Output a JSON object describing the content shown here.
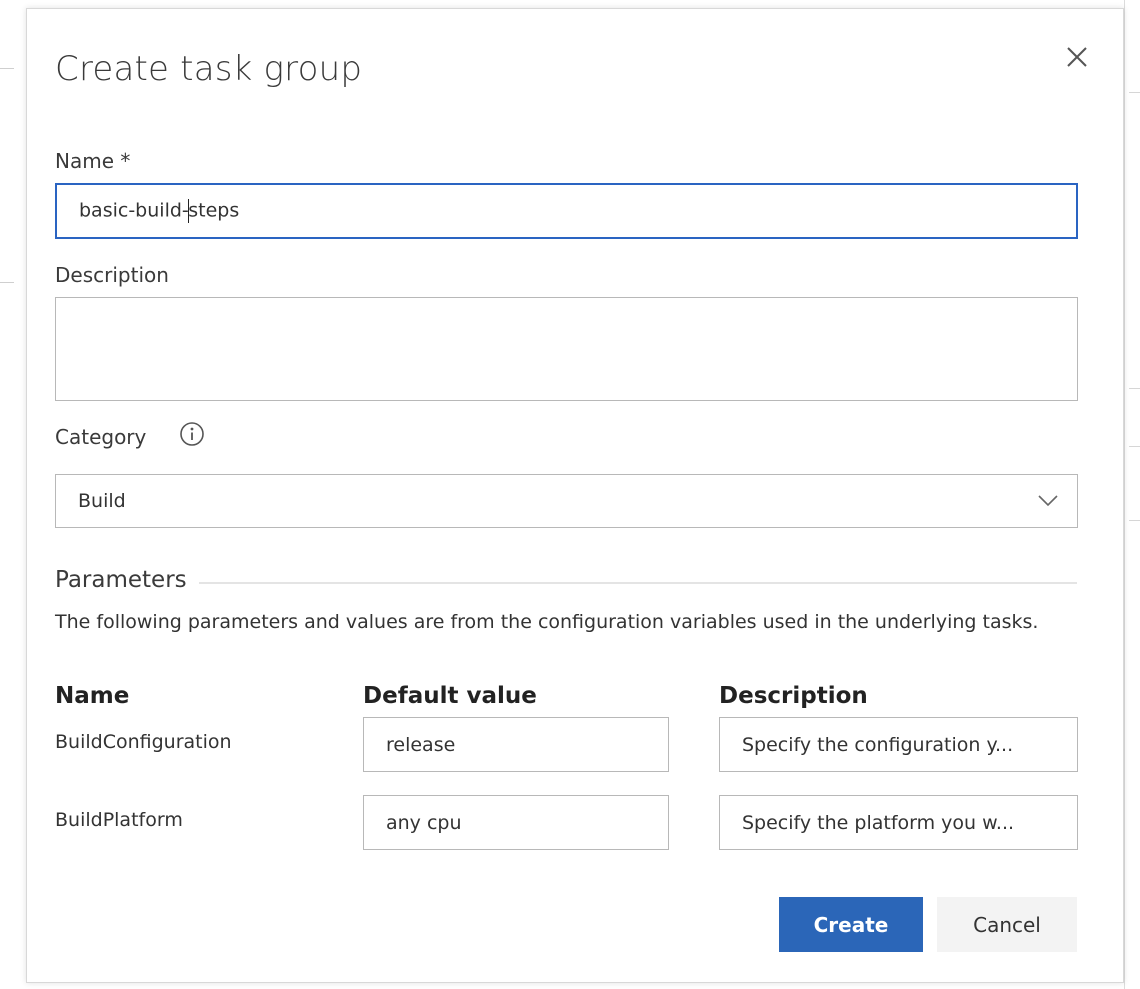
{
  "dialog": {
    "title": "Create task group",
    "close_icon": "close-icon"
  },
  "form": {
    "name_label": "Name *",
    "name_before_caret": "basic-build-",
    "name_after_caret": "steps",
    "description_label": "Description",
    "description_value": "",
    "category_label": "Category",
    "category_info_icon": "info-icon",
    "category_value": "Build",
    "category_dropdown_icon": "chevron-down-icon"
  },
  "parameters": {
    "section_title": "Parameters",
    "description": "The following parameters and values are from the configuration variables used in the underlying tasks.",
    "columns": [
      "Name",
      "Default value",
      "Description"
    ],
    "rows": [
      {
        "name": "BuildConfiguration",
        "default_value": "release",
        "description": "Specify the configuration y..."
      },
      {
        "name": "BuildPlatform",
        "default_value": "any cpu",
        "description": "Specify the platform you w..."
      }
    ]
  },
  "actions": {
    "create_label": "Create",
    "cancel_label": "Cancel"
  },
  "colors": {
    "accent": "#2b66b8",
    "focus_border": "#2a64c2"
  }
}
